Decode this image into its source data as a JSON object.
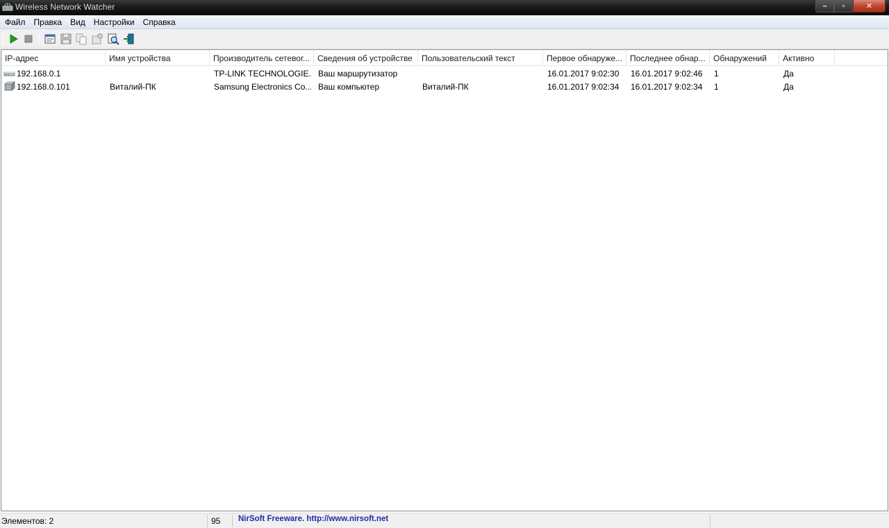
{
  "window": {
    "title": "Wireless Network Watcher",
    "buttons": {
      "minimize": "–",
      "maximize": "▫",
      "close": "✕"
    }
  },
  "menu": [
    "Файл",
    "Правка",
    "Вид",
    "Настройки",
    "Справка"
  ],
  "toolbar": {
    "items": [
      "play-icon",
      "stop-icon",
      "properties-icon",
      "save-icon",
      "copy-icon",
      "options-icon",
      "find-icon",
      "exit-icon"
    ]
  },
  "list": {
    "columns": [
      "IP-адрес",
      "Имя устройства",
      "Производитель сетевог...",
      "Сведения об устройстве",
      "Пользовательский текст",
      "Первое обнаруже...",
      "Последнее обнар...",
      "Обнаружений",
      "Активно"
    ],
    "rows": [
      {
        "icon": "router-icon",
        "ip": "192.168.0.1",
        "device_name": "",
        "vendor": "TP-LINK TECHNOLOGIE...",
        "device_info": "Ваш маршрутизатор",
        "user_text": "",
        "first_seen": "16.01.2017 9:02:30",
        "last_seen": "16.01.2017 9:02:46",
        "count": "1",
        "active": "Да"
      },
      {
        "icon": "computer-icon",
        "ip": "192.168.0.101",
        "device_name": "Виталий-ПК",
        "vendor": "Samsung Electronics Co...",
        "device_info": "Ваш компьютер",
        "user_text": "Виталий-ПК",
        "first_seen": "16.01.2017 9:02:34",
        "last_seen": "16.01.2017 9:02:34",
        "count": "1",
        "active": "Да"
      }
    ]
  },
  "status": {
    "items_count": "Элементов: 2",
    "progress_value": "95",
    "freeware_text": "NirSoft Freeware.  http://www.nirsoft.net"
  },
  "colors": {
    "link": "#1c2ea8",
    "accent_green": "#1aa31a"
  }
}
